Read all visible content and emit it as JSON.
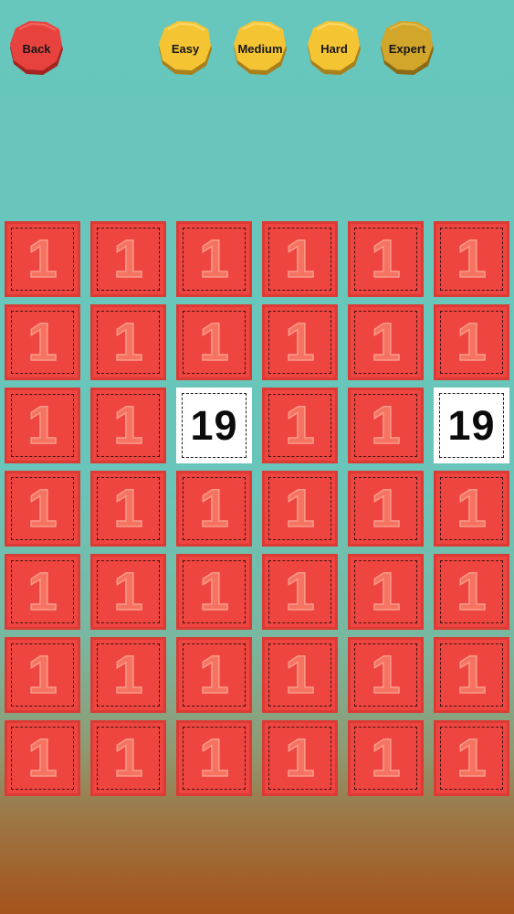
{
  "colors": {
    "back_button": "#e8423f",
    "level_button": "#f4c433",
    "level_button_selected": "#d2a52b",
    "tile_hidden": "#ef4540",
    "tile_revealed": "#ffffff",
    "background_top": "#67c7bd",
    "background_bottom": "#a4541c"
  },
  "header": {
    "back_label": "Back",
    "levels": [
      {
        "label": "Easy",
        "selected": false
      },
      {
        "label": "Medium",
        "selected": false
      },
      {
        "label": "Hard",
        "selected": false
      },
      {
        "label": "Expert",
        "selected": true
      }
    ]
  },
  "board": {
    "columns": 6,
    "rows": [
      [
        {
          "value": "1",
          "revealed": false
        },
        {
          "value": "1",
          "revealed": false
        },
        {
          "value": "1",
          "revealed": false
        },
        {
          "value": "1",
          "revealed": false
        },
        {
          "value": "1",
          "revealed": false
        },
        {
          "value": "1",
          "revealed": false
        }
      ],
      [
        {
          "value": "1",
          "revealed": false
        },
        {
          "value": "1",
          "revealed": false
        },
        {
          "value": "1",
          "revealed": false
        },
        {
          "value": "1",
          "revealed": false
        },
        {
          "value": "1",
          "revealed": false
        },
        {
          "value": "1",
          "revealed": false
        }
      ],
      [
        {
          "value": "1",
          "revealed": false
        },
        {
          "value": "1",
          "revealed": false
        },
        {
          "value": "19",
          "revealed": true
        },
        {
          "value": "1",
          "revealed": false
        },
        {
          "value": "1",
          "revealed": false
        },
        {
          "value": "19",
          "revealed": true
        }
      ],
      [
        {
          "value": "1",
          "revealed": false
        },
        {
          "value": "1",
          "revealed": false
        },
        {
          "value": "1",
          "revealed": false
        },
        {
          "value": "1",
          "revealed": false
        },
        {
          "value": "1",
          "revealed": false
        },
        {
          "value": "1",
          "revealed": false
        }
      ],
      [
        {
          "value": "1",
          "revealed": false
        },
        {
          "value": "1",
          "revealed": false
        },
        {
          "value": "1",
          "revealed": false
        },
        {
          "value": "1",
          "revealed": false
        },
        {
          "value": "1",
          "revealed": false
        },
        {
          "value": "1",
          "revealed": false
        }
      ],
      [
        {
          "value": "1",
          "revealed": false
        },
        {
          "value": "1",
          "revealed": false
        },
        {
          "value": "1",
          "revealed": false
        },
        {
          "value": "1",
          "revealed": false
        },
        {
          "value": "1",
          "revealed": false
        },
        {
          "value": "1",
          "revealed": false
        }
      ],
      [
        {
          "value": "1",
          "revealed": false
        },
        {
          "value": "1",
          "revealed": false
        },
        {
          "value": "1",
          "revealed": false
        },
        {
          "value": "1",
          "revealed": false
        },
        {
          "value": "1",
          "revealed": false
        },
        {
          "value": "1",
          "revealed": false
        }
      ]
    ]
  }
}
